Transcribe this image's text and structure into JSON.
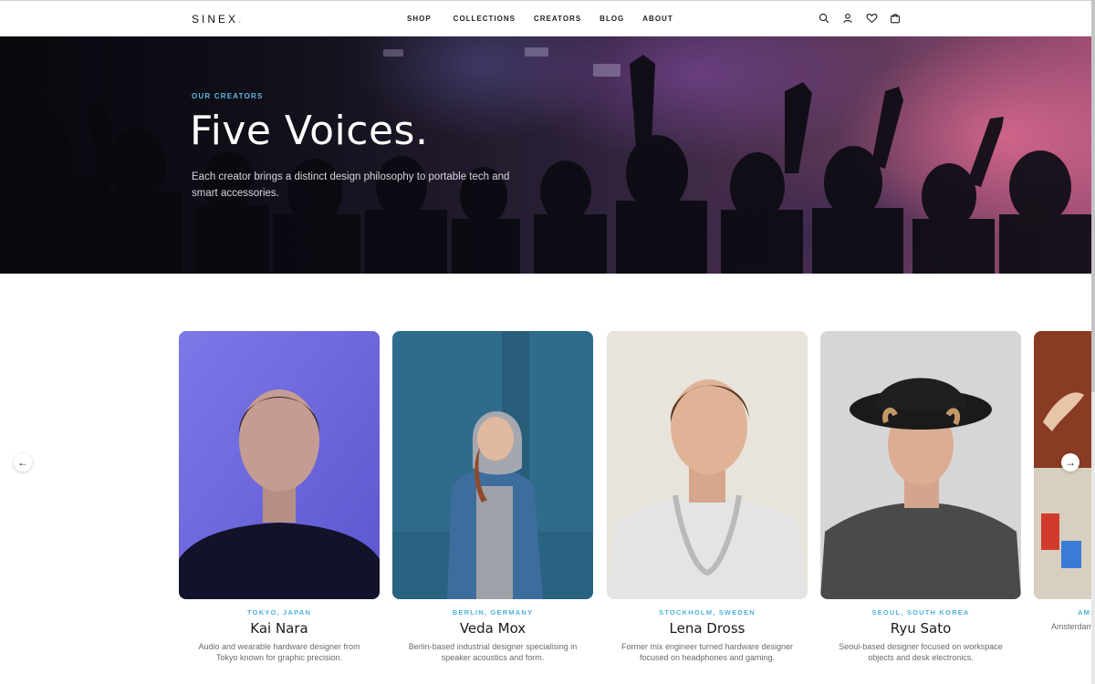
{
  "header": {
    "logo": "SINEX",
    "logo_dot": ".",
    "nav": [
      "SHOP",
      "COLLECTIONS",
      "CREATORS",
      "BLOG",
      "ABOUT"
    ],
    "icons": [
      "search-icon",
      "user-icon",
      "heart-icon",
      "cart-icon"
    ]
  },
  "hero": {
    "eyebrow": "OUR CREATORS",
    "title": "Five Voices.",
    "subtitle": "Each creator brings a distinct design philosophy to portable tech and smart accessories."
  },
  "carousel": {
    "prev_icon": "arrow-left-icon",
    "next_icon": "arrow-right-icon",
    "prev_glyph": "←",
    "next_glyph": "→",
    "cards": [
      {
        "location": "TOKYO, JAPAN",
        "name": "Kai Nara",
        "description": "Audio and wearable hardware designer from Tokyo known for graphic precision."
      },
      {
        "location": "BERLIN, GERMANY",
        "name": "Veda Mox",
        "description": "Berlin-based industrial designer specialising in speaker acoustics and form."
      },
      {
        "location": "STOCKHOLM, SWEDEN",
        "name": "Lena Dross",
        "description": "Former mix engineer turned hardware designer focused on headphones and gaming."
      },
      {
        "location": "SEOUL, SOUTH KOREA",
        "name": "Ryu Sato",
        "description": "Seoul-based designer focused on workspace objects and desk electronics."
      },
      {
        "location": "AMS",
        "name": "",
        "description": "Amsterdam limite"
      }
    ]
  },
  "colors": {
    "accent": "#4fb3dc",
    "text": "#1a1a1a",
    "muted": "#6a6a6a"
  }
}
